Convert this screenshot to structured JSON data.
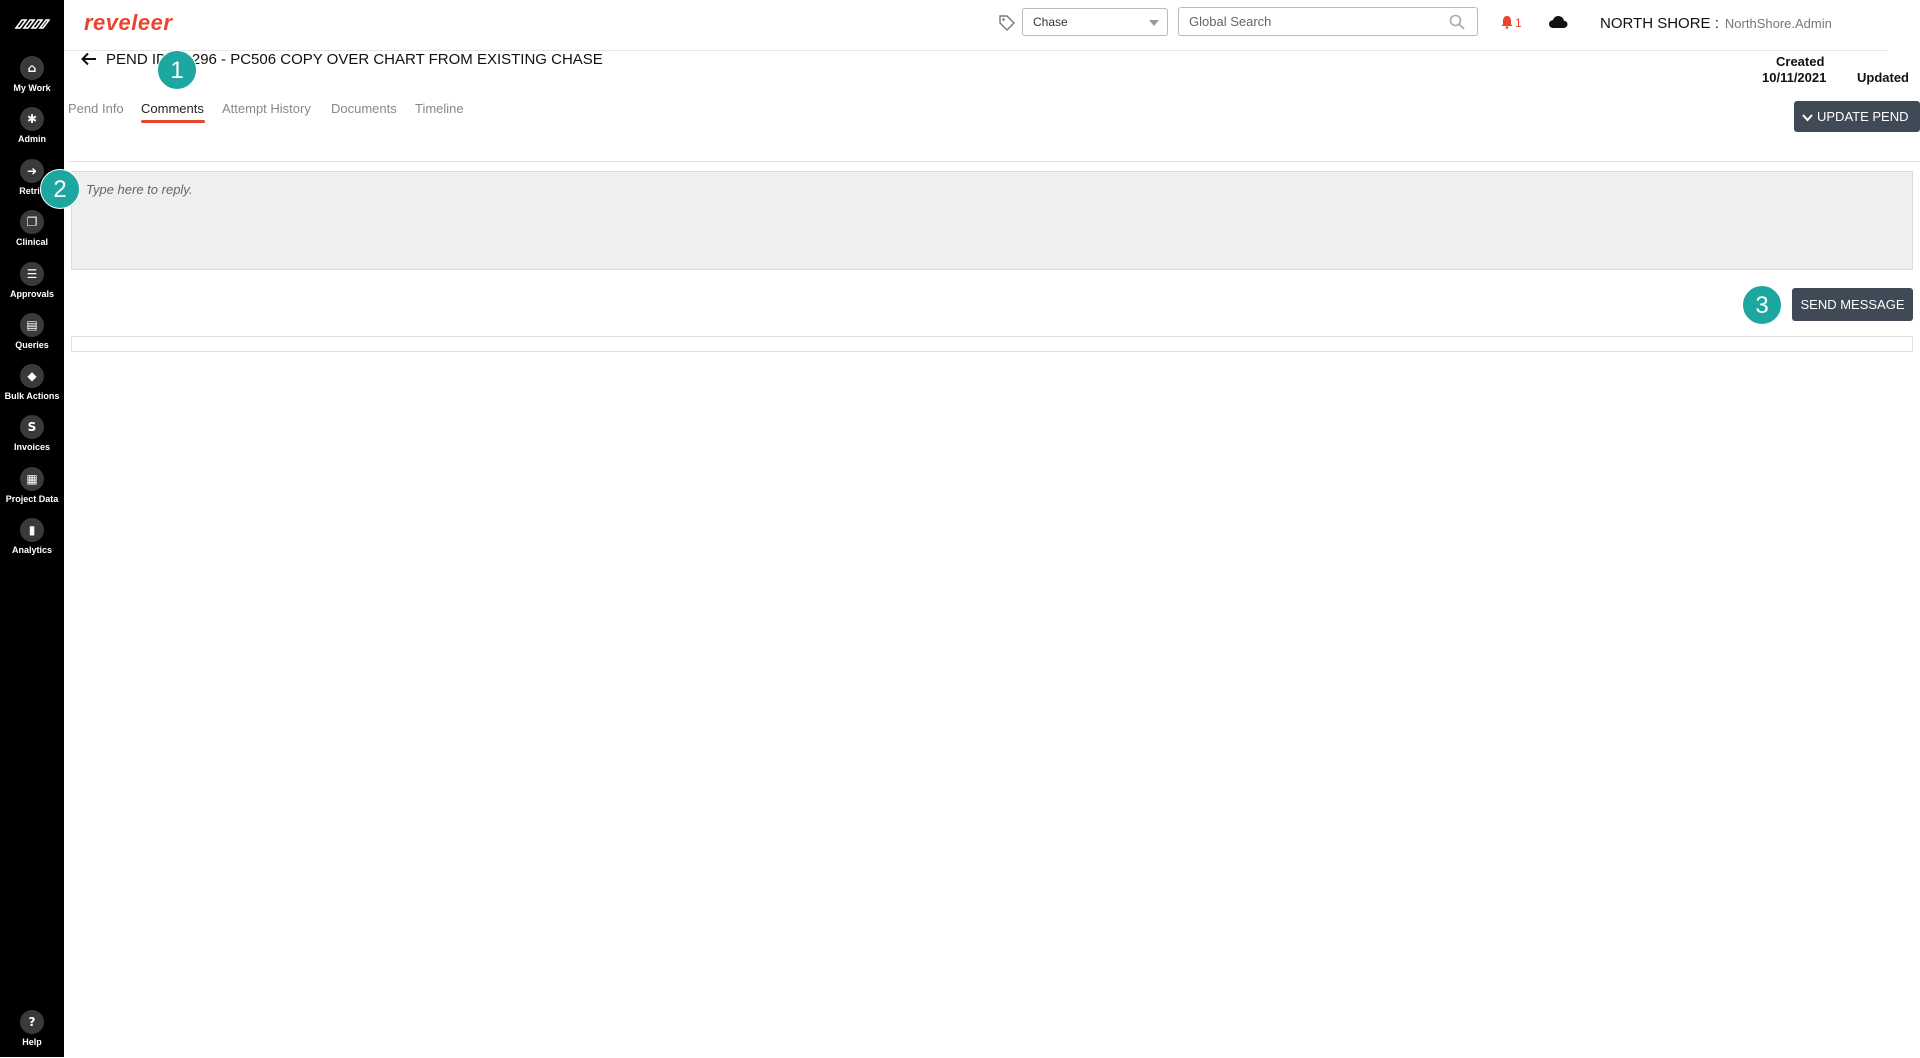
{
  "app": {
    "brand": "reveleer"
  },
  "sidebar": {
    "items": [
      {
        "label": "My Work",
        "icon": "home-icon"
      },
      {
        "label": "Admin",
        "icon": "gear-icon"
      },
      {
        "label": "Retrie",
        "icon": "arrow-right-icon"
      },
      {
        "label": "Clinical",
        "icon": "clipboard-icon"
      },
      {
        "label": "Approvals",
        "icon": "list-icon"
      },
      {
        "label": "Queries",
        "icon": "document-icon"
      },
      {
        "label": "Bulk Actions",
        "icon": "layers-icon"
      },
      {
        "label": "Invoices",
        "icon": "dollar-icon"
      },
      {
        "label": "Project Data",
        "icon": "grid-icon"
      },
      {
        "label": "Analytics",
        "icon": "chart-icon"
      }
    ],
    "help": {
      "label": "Help",
      "icon": "question-icon"
    },
    "icon_glyphs": [
      "⌂",
      "✱",
      "➜",
      "❐",
      "☰",
      "▤",
      "◆",
      "S",
      "▦",
      "▮"
    ],
    "help_glyph": "?"
  },
  "header": {
    "search_type": "Chase",
    "search_placeholder": "Global Search",
    "notification_count": "1",
    "org_name": "NORTH SHORE :",
    "user_name": "NorthShore.Admin",
    "accent_color": "#e8452c"
  },
  "page": {
    "title": "PEND ID: 61296 - PC506 COPY OVER CHART FROM EXISTING CHASE",
    "created_label": "Created",
    "created_value": "10/11/2021",
    "updated_label": "Updated"
  },
  "tabs": [
    {
      "label": "Pend Info",
      "active": false
    },
    {
      "label": "Comments",
      "active": true
    },
    {
      "label": "Attempt History",
      "active": false
    },
    {
      "label": "Documents",
      "active": false
    },
    {
      "label": "Timeline",
      "active": false
    }
  ],
  "actions": {
    "update_pend": "UPDATE PEND",
    "send_message": "SEND MESSAGE"
  },
  "reply": {
    "placeholder": "Type here to reply."
  },
  "badges": [
    "1",
    "2",
    "3"
  ]
}
